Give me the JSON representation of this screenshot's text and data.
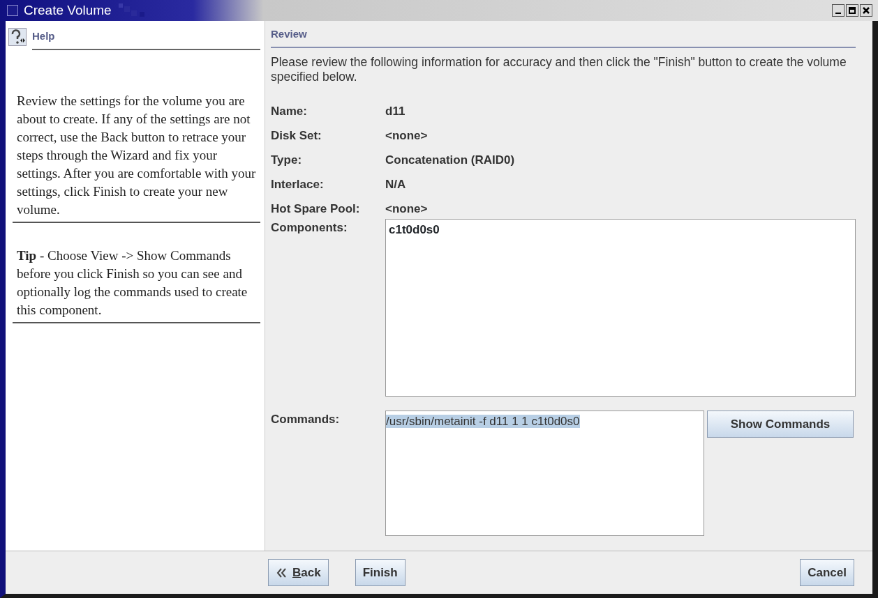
{
  "window": {
    "title": "Create Volume"
  },
  "help": {
    "title": "Help",
    "paragraphs": [
      "Review the settings for the volume you are about to create. If any of the settings are not correct, use the Back button to retrace your steps through the Wizard and fix your settings. After you are comfortable with your settings, click Finish to create your new volume.",
      "**Tip** - Choose View -> Show Commands before you click Finish so you can see and optionally log the commands used to create this component."
    ]
  },
  "review": {
    "title": "Review",
    "intro": "Please review the following information for accuracy and then click the \"Finish\" button to create the volume specified below.",
    "fields": [
      {
        "label": "Name:",
        "value": "d11"
      },
      {
        "label": "Disk Set:",
        "value": "<none>"
      },
      {
        "label": "Type:",
        "value": "Concatenation (RAID0)"
      },
      {
        "label": "Interlace:",
        "value": "N/A"
      },
      {
        "label": "Hot Spare Pool:",
        "value": "<none>"
      }
    ],
    "components": {
      "label": "Components:",
      "items": [
        "c1t0d0s0"
      ]
    },
    "commands": {
      "label": "Commands:",
      "text": "/usr/sbin/metainit -f d11 1 1 c1t0d0s0",
      "selected": true,
      "button": "Show Commands"
    }
  },
  "buttons": {
    "back": "Back",
    "finish": "Finish",
    "cancel": "Cancel"
  }
}
